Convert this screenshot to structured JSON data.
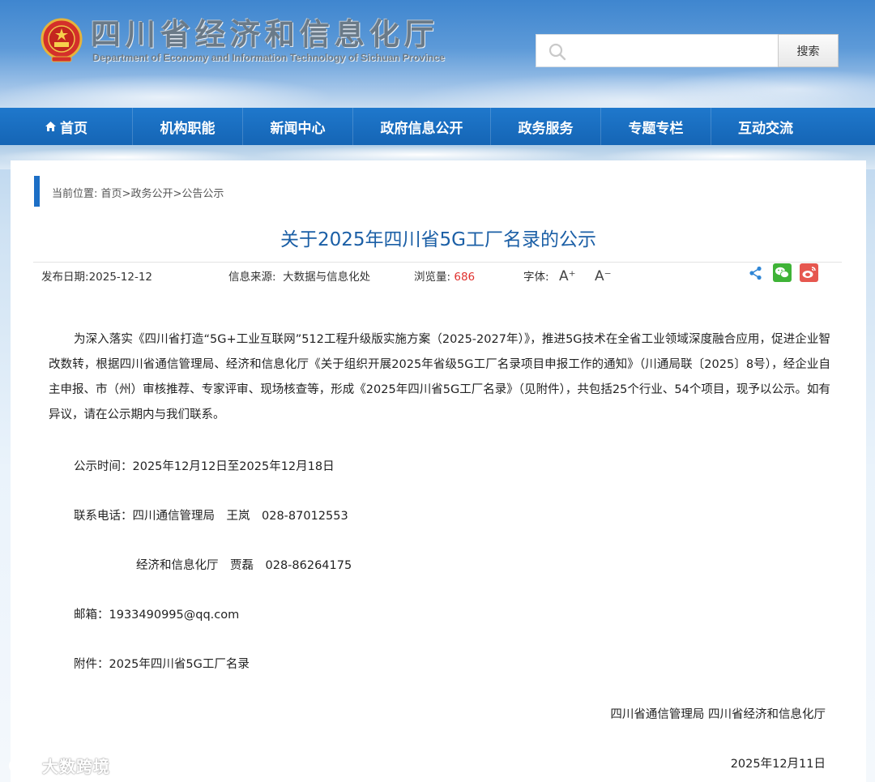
{
  "header": {
    "title": "四川省经济和信息化厅",
    "subtitle": "Department of Economy and Information Technology of Sichuan Province",
    "search_placeholder": "",
    "search_button": "搜索"
  },
  "nav": {
    "items": [
      {
        "label": "首页",
        "icon": "home-icon"
      },
      {
        "label": "机构职能"
      },
      {
        "label": "新闻中心"
      },
      {
        "label": "政府信息公开"
      },
      {
        "label": "政务服务"
      },
      {
        "label": "专题专栏"
      },
      {
        "label": "互动交流"
      }
    ]
  },
  "breadcrumb": {
    "prefix": "当前位置: ",
    "items": [
      "首页",
      "政务公开",
      "公告公示"
    ],
    "separator": ">"
  },
  "article": {
    "title": "关于2025年四川省5G工厂名录的公示",
    "publish_date_label": "发布日期:",
    "publish_date": "2025-12-12",
    "source_label": "信息来源:",
    "source": "大数据与信息化处",
    "views_label": "浏览量:",
    "views": "686",
    "font_label": "字体:",
    "font_increase": "A⁺",
    "font_decrease": "A⁻",
    "body": "为深入落实《四川省打造“5G+工业互联网”512工程升级版实施方案（2025-2027年）》，推进5G技术在全省工业领域深度融合应用，促进企业智改数转，根据四川省通信管理局、经济和信息化厅《关于组织开展2025年省级5G工厂名录项目申报工作的通知》（川通局联〔2025〕8号），经企业自主申报、市（州）审核推荐、专家评审、现场核查等，形成《2025年四川省5G工厂名录》（见附件），共包括25个行业、54个项目，现予以公示。如有异议，请在公示期内与我们联系。",
    "period": "公示时间：2025年12月12日至2025年12月18日",
    "phone1": "联系电话：四川通信管理局　王岚　028-87012553",
    "phone2": "经济和信息化厅　贾磊　028-86264175",
    "email": "邮箱：1933490995@qq.com",
    "attachment": "附件：2025年四川省5G工厂名录",
    "signature": "四川省通信管理局  四川省经济和信息化厅",
    "date": "2025年12月11日"
  },
  "watermark": {
    "text": "大数跨境"
  },
  "colors": {
    "nav_bg": "#1565b5",
    "title_blue": "#1b5fa6",
    "accent_bar": "#1c6fc6",
    "views_red": "#e0302d",
    "wechat_green": "#3fb337",
    "weibo_red": "#e6574f"
  }
}
